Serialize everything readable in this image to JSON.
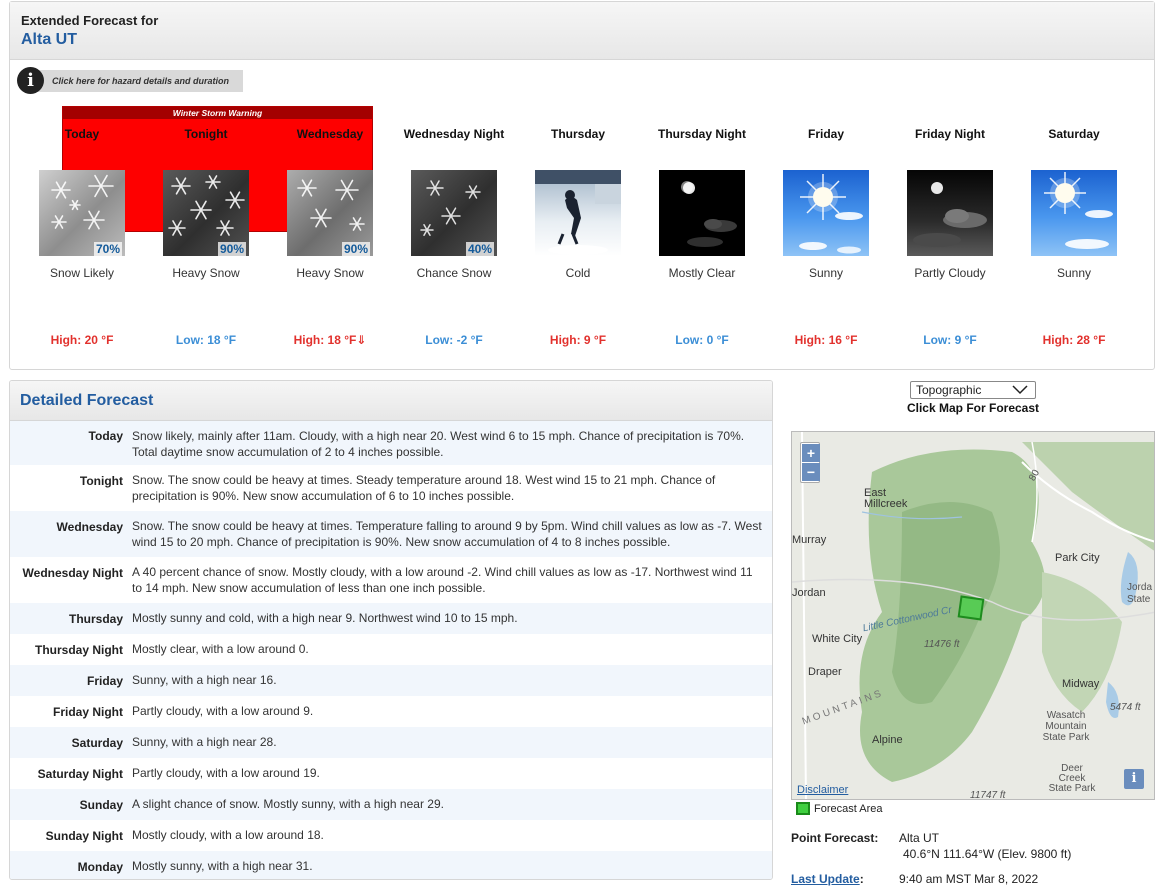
{
  "header": {
    "label": "Extended Forecast for",
    "location": "Alta UT"
  },
  "hazard": {
    "link_text": "Click here for hazard details and duration",
    "warning": "Winter Storm Warning"
  },
  "periods": [
    {
      "name": "Today",
      "icon": "snow-icon",
      "pop": "70%",
      "short": "Snow Likely",
      "temp": "High: 20 °F",
      "kind": "hi"
    },
    {
      "name": "Tonight",
      "icon": "heavy-snow-icon",
      "pop": "90%",
      "short": "Heavy Snow",
      "temp": "Low: 18 °F",
      "kind": "lo"
    },
    {
      "name": "Wednesday",
      "icon": "heavy-snow-icon",
      "pop": "90%",
      "short": "Heavy Snow",
      "temp": "High: 18 °F⇓",
      "kind": "hi"
    },
    {
      "name": "Wednesday Night",
      "icon": "chance-snow-icon",
      "pop": "40%",
      "short": "Chance Snow",
      "temp": "Low: -2 °F",
      "kind": "lo"
    },
    {
      "name": "Thursday",
      "icon": "cold-icon",
      "pop": "",
      "short": "Cold",
      "temp": "High: 9 °F",
      "kind": "hi"
    },
    {
      "name": "Thursday Night",
      "icon": "mostly-clear-night-icon",
      "pop": "",
      "short": "Mostly Clear",
      "temp": "Low: 0 °F",
      "kind": "lo"
    },
    {
      "name": "Friday",
      "icon": "sunny-icon",
      "pop": "",
      "short": "Sunny",
      "temp": "High: 16 °F",
      "kind": "hi"
    },
    {
      "name": "Friday Night",
      "icon": "partly-cloudy-night-icon",
      "pop": "",
      "short": "Partly Cloudy",
      "temp": "Low: 9 °F",
      "kind": "lo"
    },
    {
      "name": "Saturday",
      "icon": "sunny-icon",
      "pop": "",
      "short": "Sunny",
      "temp": "High: 28 °F",
      "kind": "hi"
    }
  ],
  "detailed": {
    "title": "Detailed Forecast",
    "rows": [
      {
        "label": "Today",
        "text": "Snow likely, mainly after 11am. Cloudy, with a high near 20. West wind 6 to 15 mph. Chance of precipitation is 70%. Total daytime snow accumulation of 2 to 4 inches possible."
      },
      {
        "label": "Tonight",
        "text": "Snow. The snow could be heavy at times. Steady temperature around 18. West wind 15 to 21 mph. Chance of precipitation is 90%. New snow accumulation of 6 to 10 inches possible."
      },
      {
        "label": "Wednesday",
        "text": "Snow. The snow could be heavy at times. Temperature falling to around 9 by 5pm. Wind chill values as low as -7. West wind 15 to 20 mph. Chance of precipitation is 90%. New snow accumulation of 4 to 8 inches possible."
      },
      {
        "label": "Wednesday Night",
        "text": "A 40 percent chance of snow. Mostly cloudy, with a low around -2. Wind chill values as low as -17. Northwest wind 11 to 14 mph. New snow accumulation of less than one inch possible."
      },
      {
        "label": "Thursday",
        "text": "Mostly sunny and cold, with a high near 9. Northwest wind 10 to 15 mph."
      },
      {
        "label": "Thursday Night",
        "text": "Mostly clear, with a low around 0."
      },
      {
        "label": "Friday",
        "text": "Sunny, with a high near 16."
      },
      {
        "label": "Friday Night",
        "text": "Partly cloudy, with a low around 9."
      },
      {
        "label": "Saturday",
        "text": "Sunny, with a high near 28."
      },
      {
        "label": "Saturday Night",
        "text": "Partly cloudy, with a low around 19."
      },
      {
        "label": "Sunday",
        "text": "A slight chance of snow. Mostly sunny, with a high near 29."
      },
      {
        "label": "Sunday Night",
        "text": "Mostly cloudy, with a low around 18."
      },
      {
        "label": "Monday",
        "text": "Mostly sunny, with a high near 31."
      }
    ]
  },
  "map": {
    "select_value": "Topographic",
    "caption": "Click Map For Forecast",
    "zoom_in": "+",
    "zoom_out": "−",
    "info": "i",
    "disclaimer": "Disclaimer",
    "labels": {
      "east_millcreek": "East Millcreek",
      "murray": "Murray",
      "park_city": "Park City",
      "jordan": "Jordan",
      "jordanelle": "Jorda",
      "state": "State",
      "little_cottonwood": "Little Cottonwood Cr",
      "white_city": "White City",
      "elev1": "11476 ft",
      "draper": "Draper",
      "midway": "Midway",
      "wasatch": "Wasatch Mountain State Park",
      "elev2": "5474 ft",
      "mountains": "MOUNTAINS",
      "alpine": "Alpine",
      "deer_creek": "Deer Creek State Park",
      "elev3": "11747 ft",
      "hwy": "80"
    },
    "legend": "Forecast Area"
  },
  "point": {
    "label": "Point Forecast:",
    "name": "Alta UT",
    "coords": "40.6°N 111.64°W (Elev. 9800 ft)",
    "update_label": "Last Update",
    "update_colon": ":",
    "update_value": "9:40 am MST Mar 8, 2022"
  },
  "colors": {
    "accent": "#235da0",
    "warning": "#fe0000",
    "high": "#e2312d",
    "low": "#3b8ed6"
  }
}
